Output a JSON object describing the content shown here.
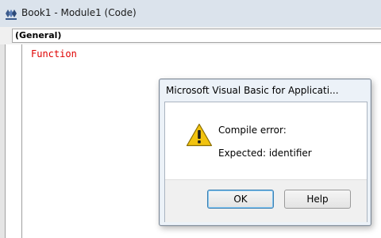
{
  "code_window": {
    "title": "Book1 - Module1 (Code)",
    "object_dropdown": "(General)",
    "code_lines": [
      "Function"
    ]
  },
  "dialog": {
    "title": "Microsoft Visual Basic for Applicati...",
    "message_heading": "Compile error:",
    "message_detail": "Expected: identifier",
    "ok_label": "OK",
    "help_label": "Help",
    "icon": "warning-icon"
  },
  "colors": {
    "keyword_error": "#e00000",
    "titlebar": "#dbe3ec",
    "dialog_frame": "#ecf2f8",
    "warning_fill": "#f2c30f"
  }
}
